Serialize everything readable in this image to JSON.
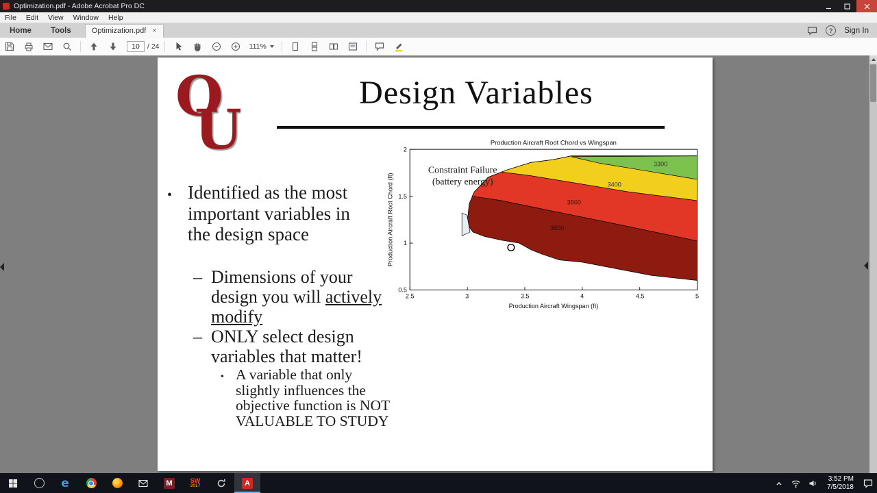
{
  "window": {
    "title": "Optimization.pdf - Adobe Acrobat Pro DC",
    "menu_items": [
      "File",
      "Edit",
      "View",
      "Window",
      "Help"
    ]
  },
  "tabs": {
    "home": "Home",
    "tools": "Tools",
    "document": "Optimization.pdf",
    "close_glyph": "×",
    "help_glyph": "?",
    "sign_in": "Sign In"
  },
  "toolbar": {
    "page_current": "10",
    "page_total": "/ 24",
    "zoom_level": "111%"
  },
  "slide": {
    "logo_o": "O",
    "logo_u": "U",
    "logo_color": "#9b1a20",
    "title": "Design Variables",
    "bullet_glyph": "•",
    "dash_glyph": "–",
    "bullet1": "Identified as the most important variables in the design space",
    "sub1_pre": "Dimensions of your design you will",
    "sub1_underline": "actively modify",
    "sub2": "ONLY select design variables that matter!",
    "subsub1": "A variable that only slightly influences the objective function is NOT VALUABLE TO STUDY"
  },
  "chart_data": {
    "type": "contour",
    "title": "Production Aircraft Root Chord vs Wingspan",
    "xlabel": "Production Aircraft Wingspan (ft)",
    "ylabel": "Production Aircraft Root Chord (ft)",
    "xlim": [
      2.5,
      5
    ],
    "ylim": [
      0.5,
      2
    ],
    "x_tick_labels": [
      "2.5",
      "3",
      "3.5",
      "4",
      "4.5",
      "5"
    ],
    "y_tick_labels": [
      "0.5",
      "1",
      "1.5",
      "2"
    ],
    "annotation_line1": "Constraint Failure",
    "annotation_line2": "(battery energy)",
    "legend_position": "none",
    "bands": [
      {
        "label": "3600",
        "color": "#8e1b10"
      },
      {
        "label": "3500",
        "color": "#e23626"
      },
      {
        "label": "3400",
        "color": "#f3cf1d"
      },
      {
        "label": "3300",
        "color": "#7dc14e"
      }
    ],
    "marker": {
      "x": 3.4,
      "y": 0.97
    }
  },
  "taskbar": {
    "edge_glyph": "e",
    "m_glyph": "M",
    "sw_label": "SW",
    "sw_year": "2017",
    "acrobat_glyph": "A",
    "time": "3:52 PM",
    "date": "7/5/2018"
  }
}
